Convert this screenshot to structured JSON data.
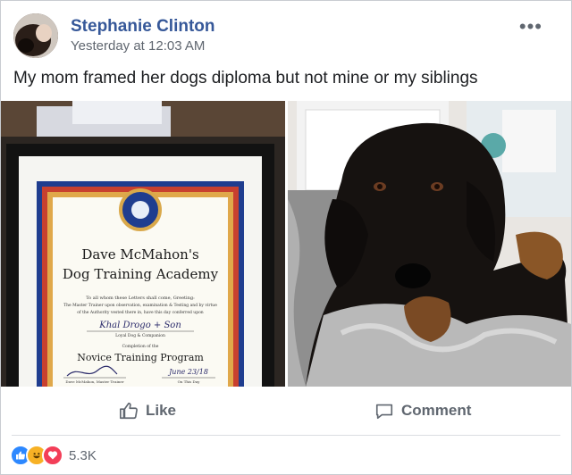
{
  "post": {
    "author": "Stephanie Clinton",
    "timestamp": "Yesterday at 12:03 AM",
    "more_icon": "more-dots-icon",
    "text": "My mom framed her dogs diploma but not mine or my siblings"
  },
  "diploma": {
    "line1": "Dave McMahon's",
    "line2": "Dog Training Academy",
    "small1": "To all whom these Letters shall come, Greeting:",
    "small2": "The Master Trainer upon observation, examination & Testing and by virtue",
    "small3": "of the Authority vested there in, have this day conferred upon",
    "signed_name": "Khal Drogo + Son",
    "loyal": "Loyal Dog & Companion",
    "completion": "Completion of the",
    "program": "Novice Training Program",
    "date": "June 23/18",
    "sig_label_left": "Dave McMahon, Master Trainer",
    "sig_label_right": "On This Day"
  },
  "actions": {
    "like_label": "Like",
    "comment_label": "Comment"
  },
  "reactions": {
    "icons": [
      "like-icon",
      "haha-icon",
      "love-icon"
    ],
    "count": "5.3K"
  },
  "colors": {
    "name": "#365899",
    "meta": "#606770",
    "like_blue": "#2d88ff",
    "haha": "#f7b125",
    "love": "#f33e58"
  }
}
